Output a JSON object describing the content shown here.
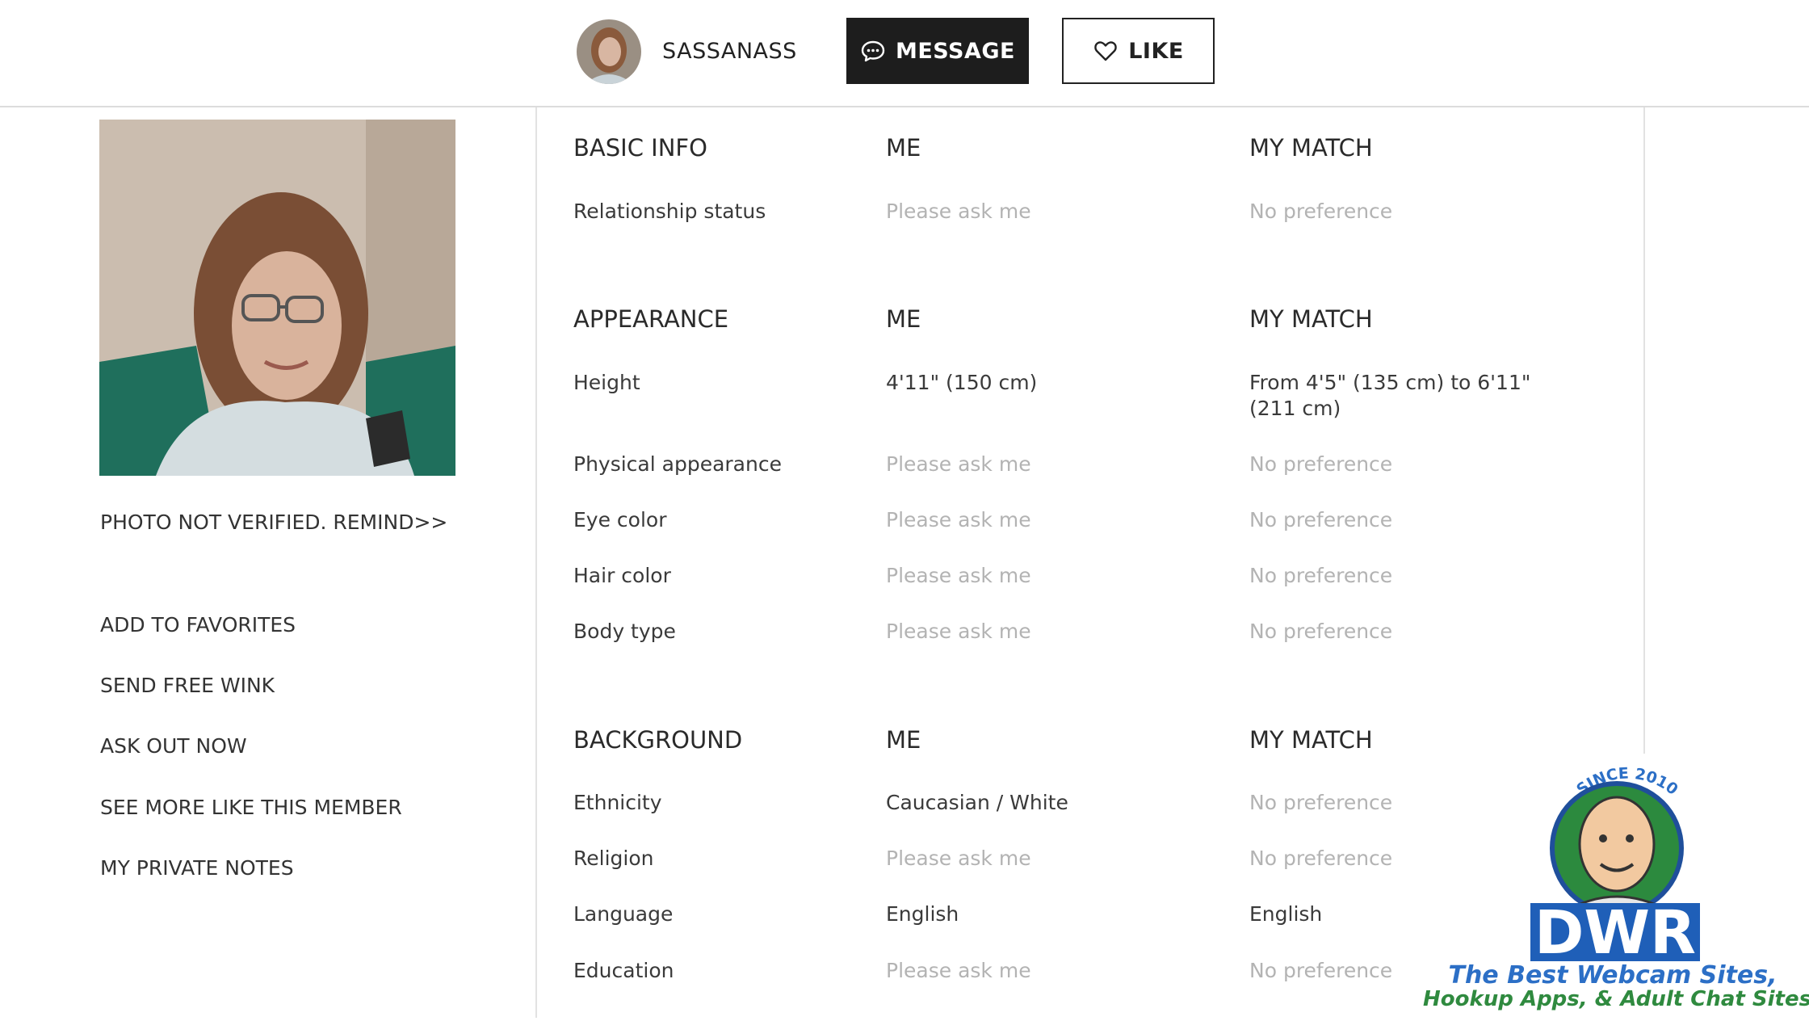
{
  "header": {
    "username": "SASSANASS",
    "message_label": "MESSAGE",
    "like_label": "LIKE"
  },
  "icons": {
    "message": "chat-bubble-icon",
    "like": "heart-icon"
  },
  "sidebar": {
    "photo_status": "PHOTO NOT VERIFIED. REMIND>>",
    "links": [
      "ADD TO FAVORITES",
      "SEND FREE WINK",
      "ASK OUT NOW",
      "SEE MORE LIKE THIS MEMBER",
      "MY PRIVATE NOTES"
    ]
  },
  "sections": [
    {
      "title": "BASIC INFO",
      "me_header": "ME",
      "match_header": "MY MATCH",
      "rows": [
        {
          "label": "Relationship status",
          "me": "Please ask me",
          "match": "No preference"
        }
      ]
    },
    {
      "title": "APPEARANCE",
      "me_header": "ME",
      "match_header": "MY MATCH",
      "rows": [
        {
          "label": "Height",
          "me": "4'11\" (150 cm)",
          "match": "From 4'5\" (135 cm) to 6'11\" (211 cm)"
        },
        {
          "label": "Physical appearance",
          "me": "Please ask me",
          "match": "No preference"
        },
        {
          "label": "Eye color",
          "me": "Please ask me",
          "match": "No preference"
        },
        {
          "label": "Hair color",
          "me": "Please ask me",
          "match": "No preference"
        },
        {
          "label": "Body type",
          "me": "Please ask me",
          "match": "No preference"
        }
      ]
    },
    {
      "title": "BACKGROUND",
      "me_header": "ME",
      "match_header": "MY MATCH",
      "rows": [
        {
          "label": "Ethnicity",
          "me": "Caucasian / White",
          "match": "No preference"
        },
        {
          "label": "Religion",
          "me": "Please ask me",
          "match": "No preference"
        },
        {
          "label": "Language",
          "me": "English",
          "match": "English"
        },
        {
          "label": "Education",
          "me": "Please ask me",
          "match": "No preference"
        }
      ]
    }
  ],
  "watermark": {
    "since": "SINCE 2010",
    "brand": "DWR",
    "tagline_1": "The Best Webcam Sites,",
    "tagline_2": "Hookup Apps, & Adult Chat Sites!"
  }
}
